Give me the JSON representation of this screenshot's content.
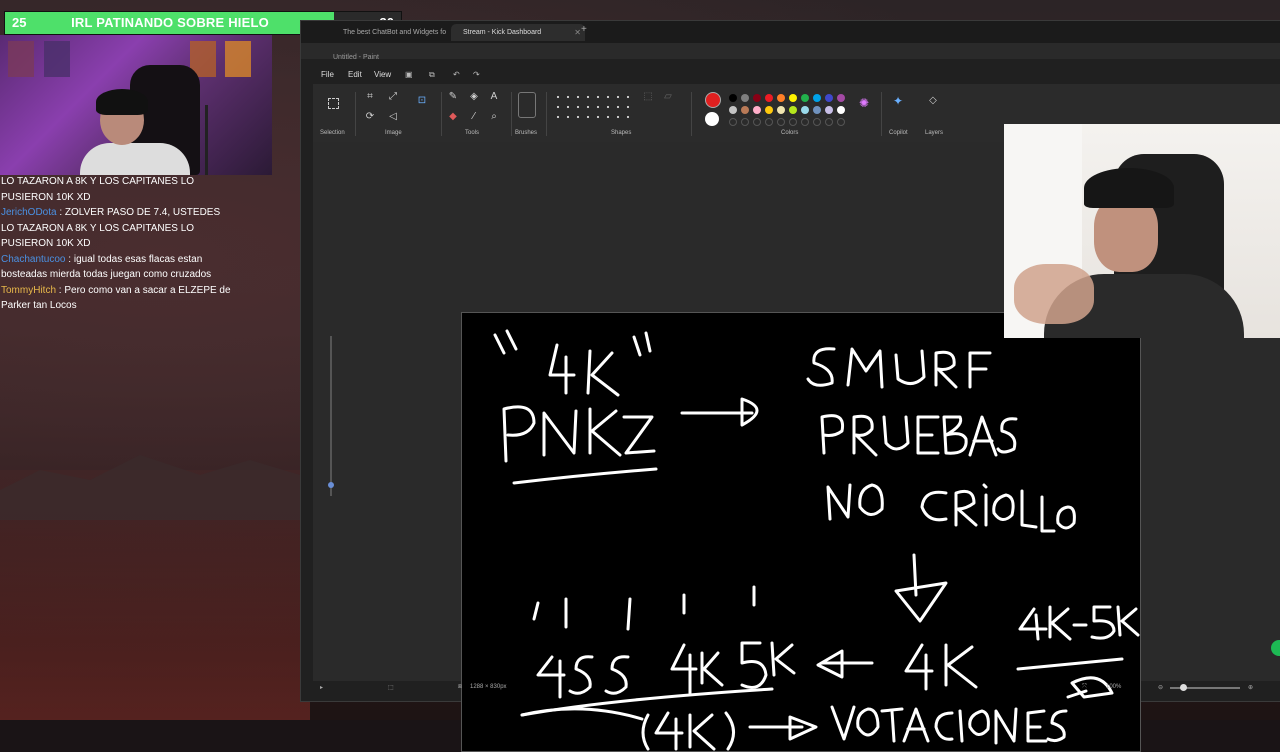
{
  "banner": {
    "left_number": "25",
    "title": "IRL PATINANDO SOBRE HIELO",
    "right_number": "30",
    "progress_fraction": 0.83,
    "fill_color": "#4ee06a"
  },
  "chat": {
    "lines": [
      {
        "user": "",
        "text": "LO TAZARON A 8K Y LOS CAPITANES LO"
      },
      {
        "user": "",
        "text": "PUSIERON 10K XD"
      },
      {
        "user": "JerichODota",
        "text": "ZOLVER PASO DE 7.4, USTEDES"
      },
      {
        "user": "",
        "text": "LO TAZARON A 8K Y LOS CAPITANES LO"
      },
      {
        "user": "",
        "text": "PUSIERON 10K XD"
      },
      {
        "user": "Chachantucoo",
        "text": "igual todas esas flacas estan"
      },
      {
        "user": "",
        "text": "bosteadas mierda todas juegan como cruzados"
      },
      {
        "user": "TommyHitch",
        "text": "Pero como van a sacar a ELZEPE de"
      },
      {
        "user": "",
        "text": "Parker tan Locos"
      }
    ]
  },
  "browser": {
    "tabs": [
      {
        "label": "The best ChatBot and Widgets fo",
        "active": false
      },
      {
        "label": "Stream - Kick Dashboard",
        "active": true
      }
    ],
    "new_tab": "+"
  },
  "paint": {
    "window_title": "Untitled - Paint",
    "menu": [
      "File",
      "Edit",
      "View"
    ],
    "groups": {
      "selection": "Selection",
      "image": "Image",
      "tools": "Tools",
      "brushes": "Brushes",
      "shapes": "Shapes",
      "colors": "Colors",
      "copilot": "Copilot",
      "layers": "Layers"
    },
    "status": {
      "canvas_size": "1288 × 830px",
      "zoom": "100%"
    }
  },
  "colors": {
    "primary": "#e02020",
    "secondary": "#ffffff",
    "palette": [
      "#000000",
      "#7f7f7f",
      "#880015",
      "#ed1c24",
      "#ff7f27",
      "#fff200",
      "#22b14c",
      "#00a2e8",
      "#3f48cc",
      "#a349a4",
      "#c3c3c3",
      "#b97a57",
      "#ffaec9",
      "#ffc90e",
      "#efe4b0",
      "#b5e61d",
      "#99d9ea",
      "#7092be",
      "#c8bfe7",
      "#ffffff"
    ]
  },
  "drawing": {
    "words": [
      "\"4K\"",
      "PNKZ",
      "SMURF",
      "PRUEBAS",
      "NO CRIOLLO",
      "4SS",
      "4K",
      "5K",
      "4K",
      "4K-5K",
      "(4K)",
      "VOTACIONES"
    ]
  }
}
